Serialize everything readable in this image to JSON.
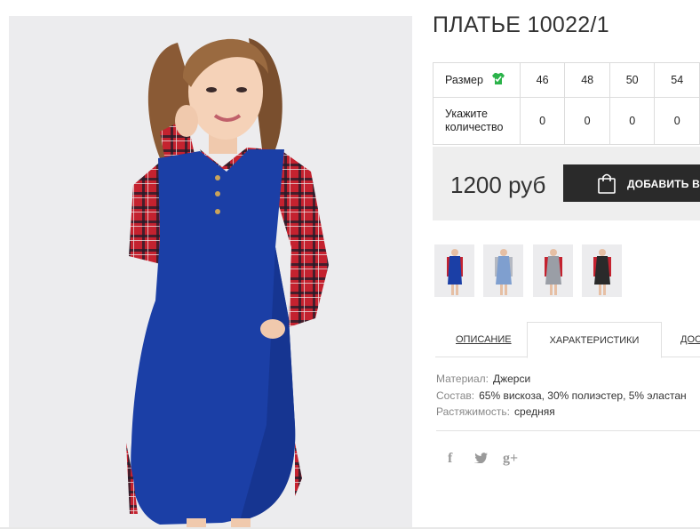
{
  "product": {
    "title": "ПЛАТЬЕ 10022/1"
  },
  "size_table": {
    "size_label": "Размер",
    "qty_label": "Укажите количество",
    "sizes": [
      "46",
      "48",
      "50",
      "54"
    ],
    "quantities": [
      "0",
      "0",
      "0",
      "0"
    ]
  },
  "price": {
    "value": "1200 руб",
    "add_to_cart_label": "ДОБАВИТЬ В З"
  },
  "tabs": {
    "items": [
      {
        "label": "ОПИСАНИЕ"
      },
      {
        "label": "ХАРАКТЕРИСТИКИ"
      },
      {
        "label": "ДОС"
      }
    ],
    "active": "ХАРАКТЕРИСТИКИ"
  },
  "specs": [
    {
      "key": "Материал:",
      "value": "Джерси"
    },
    {
      "key": "Состав:",
      "value": "65% вискоза, 30% полиэстер, 5% эластан"
    },
    {
      "key": "Растяжимость:",
      "value": "средняя"
    }
  ],
  "social": {
    "facebook": "f",
    "twitter": "twitter-icon",
    "gplus": "g+"
  },
  "colors": {
    "dress_blue": "#1b3fa6",
    "plaid_red": "#c4222f",
    "button_dark": "#2a2a2a",
    "size_icon_green": "#2bb34a"
  },
  "thumbnails": [
    {
      "dress_color": "#1b3fa6",
      "sleeve_color": "#c4222f"
    },
    {
      "dress_color": "#7f9fcf",
      "sleeve_color": "#b5b9c2"
    },
    {
      "dress_color": "#9a9ea6",
      "sleeve_color": "#c4222f"
    },
    {
      "dress_color": "#2a2a2a",
      "sleeve_color": "#c4222f"
    }
  ]
}
